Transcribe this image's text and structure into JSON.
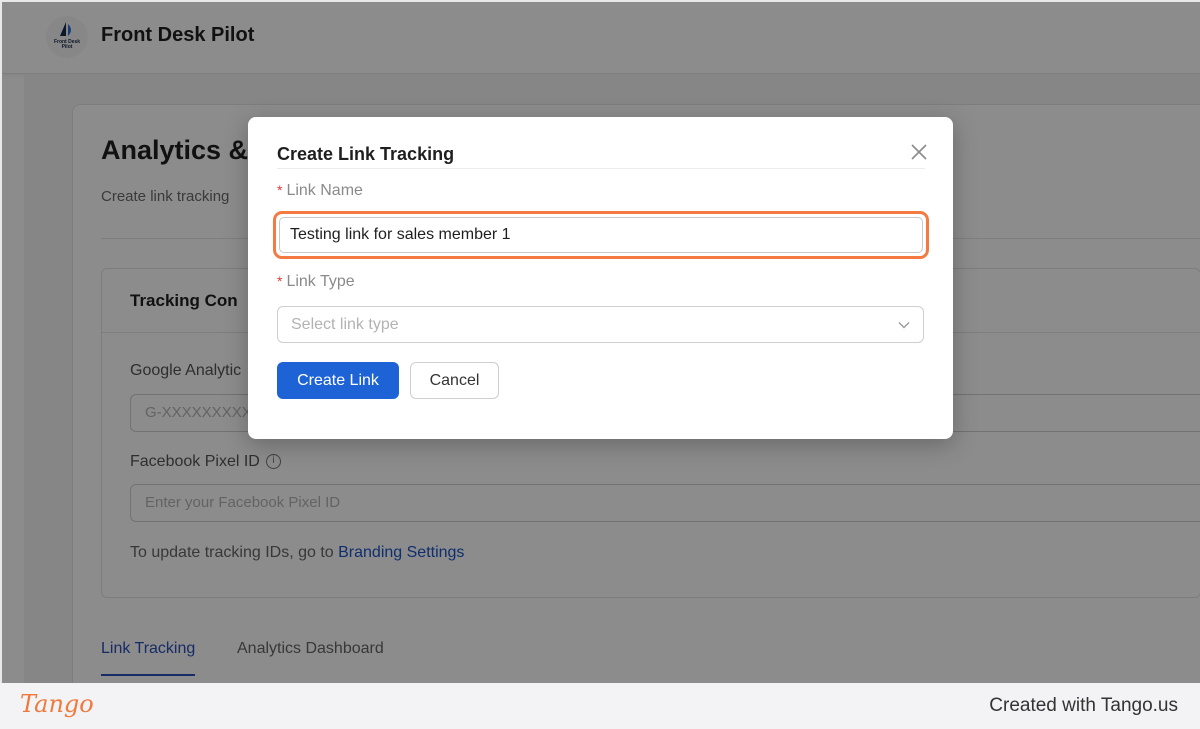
{
  "app": {
    "title": "Front Desk Pilot",
    "logo_text": "Front Desk Pilot"
  },
  "page": {
    "title": "Analytics &",
    "subtitle": "Create link tracking",
    "tracking_card": {
      "title": "Tracking Con",
      "google_label": "Google Analytic",
      "google_placeholder": "G-XXXXXXXXX",
      "facebook_label": "Facebook Pixel ID",
      "facebook_placeholder": "Enter your Facebook Pixel ID",
      "helper_text": "To update tracking IDs, go to ",
      "helper_link": "Branding Settings"
    },
    "tabs": [
      {
        "label": "Link Tracking",
        "active": true
      },
      {
        "label": "Analytics Dashboard",
        "active": false
      }
    ]
  },
  "modal": {
    "title": "Create Link Tracking",
    "link_name_label": "Link Name",
    "link_name_value": "Testing link for sales member 1",
    "link_type_label": "Link Type",
    "link_type_placeholder": "Select link type",
    "create_label": "Create Link",
    "cancel_label": "Cancel",
    "required_mark": "*"
  },
  "footer": {
    "brand": "Tango",
    "text": "Created with Tango.us"
  },
  "colors": {
    "primary": "#1d63d6",
    "highlight": "#f47a42",
    "link": "#1d55c9",
    "required": "#e53935"
  }
}
